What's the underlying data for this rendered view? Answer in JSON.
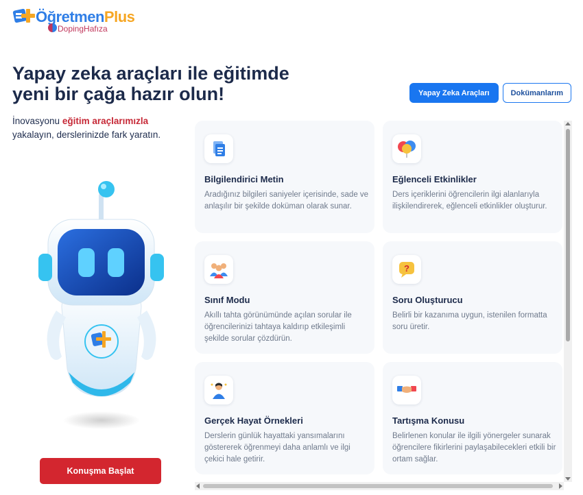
{
  "brand": {
    "title_main": "Öğretmen",
    "title_plus": "Plus",
    "sub": "DopingHafıza"
  },
  "hero": {
    "title_line1": "Yapay zeka araçları ile eğitimde",
    "title_line2": "yeni bir çağa hazır olun!"
  },
  "buttons": {
    "ai_tools": "Yapay Zeka Araçları",
    "documents": "Dokümanlarım",
    "start_chat": "Konuşma Başlat"
  },
  "lead": {
    "part1": "İnovasyonu ",
    "highlight": "eğitim araçlarımızla",
    "part2": "yakalayın, derslerinizde fark yaratın."
  },
  "cards": [
    {
      "icon": "document-icon",
      "title": "Bilgilendirici Metin",
      "desc": "Aradığınız bilgileri saniyeler içerisinde, sade ve anlaşılır bir şekilde doküman olarak sunar."
    },
    {
      "icon": "balloons-icon",
      "title": "Eğlenceli Etkinlikler",
      "desc": "Ders içeriklerini öğrencilerin ilgi alanlarıyla ilişkilendirerek, eğlenceli etkinlikler oluşturur."
    },
    {
      "icon": "classroom-icon",
      "title": "Sınıf Modu",
      "desc": "Akıllı tahta görünümünde açılan sorular ile öğrencilerinizi tahtaya kaldırıp etkileşimli şekilde sorular çözdürün."
    },
    {
      "icon": "question-bubble-icon",
      "title": "Soru Oluşturucu",
      "desc": "Belirli bir kazanıma uygun, istenilen formatta soru üretir."
    },
    {
      "icon": "person-idea-icon",
      "title": "Gerçek Hayat Örnekleri",
      "desc": "Derslerin günlük hayattaki yansımalarını göstererek öğrenmeyi daha anlamlı ve ilgi çekici hale getirir."
    },
    {
      "icon": "handshake-icon",
      "title": "Tartışma Konusu",
      "desc": "Belirlenen konular ile ilgili yönergeler sunarak öğrencilere fikirlerini paylaşabilecekleri etkili bir ortam sağlar."
    }
  ],
  "colors": {
    "primary": "#1976f0",
    "danger": "#d3262f",
    "highlight": "#c62836",
    "heading": "#1c2a4a",
    "card_bg": "#f6f8fb"
  }
}
